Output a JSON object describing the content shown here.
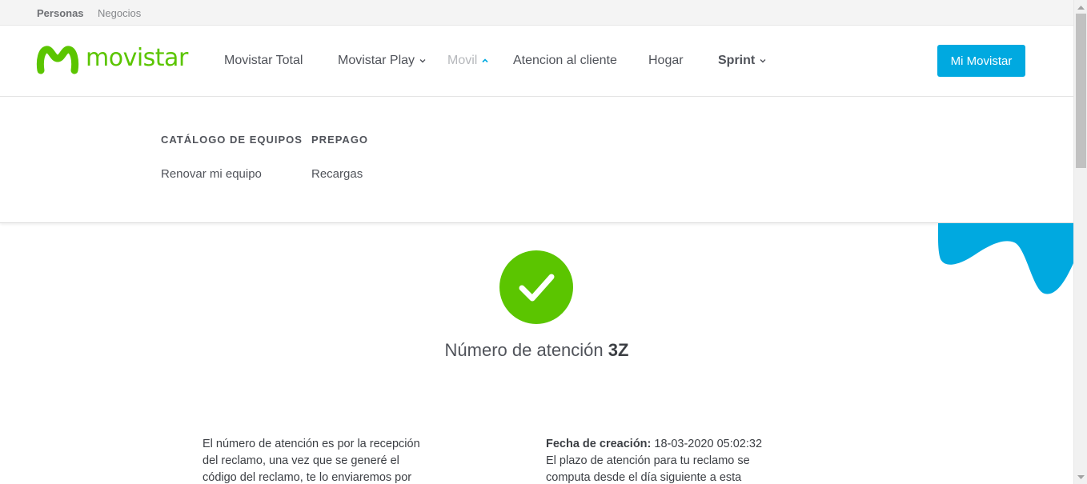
{
  "topbar": {
    "personas": "Personas",
    "negocios": "Negocios"
  },
  "header": {
    "logo_text": "movistar",
    "nav": [
      {
        "label": "Movistar Total"
      },
      {
        "label": "Movistar Play"
      },
      {
        "label": "Movil"
      },
      {
        "label": "Atencion al cliente"
      },
      {
        "label": "Hogar"
      },
      {
        "label": "Sprint"
      }
    ],
    "mi_movistar": "Mi Movistar"
  },
  "dropdown": {
    "columns": [
      {
        "heading": "CATÁLOGO DE EQUIPOS",
        "link": "Renovar mi equipo"
      },
      {
        "heading": "PREPAGO",
        "link": "Recargas"
      }
    ]
  },
  "result": {
    "label": "Número de atención",
    "number": "3Z"
  },
  "details": {
    "left_text": "El número de atención es por la recepción del reclamo, una vez que se generé el código del reclamo, te lo enviaremos por",
    "created_label": "Fecha de creación:",
    "created_value": "18-03-2020 05:02:32",
    "right_text": "El plazo de atención para tu reclamo se computa desde el día siguiente a esta"
  },
  "colors": {
    "brand_green": "#5bc500",
    "accent_blue": "#00a9e0"
  },
  "icons": {
    "check": "check-icon",
    "chevron_down": "chevron-down-icon",
    "chevron_up": "chevron-up-icon"
  }
}
